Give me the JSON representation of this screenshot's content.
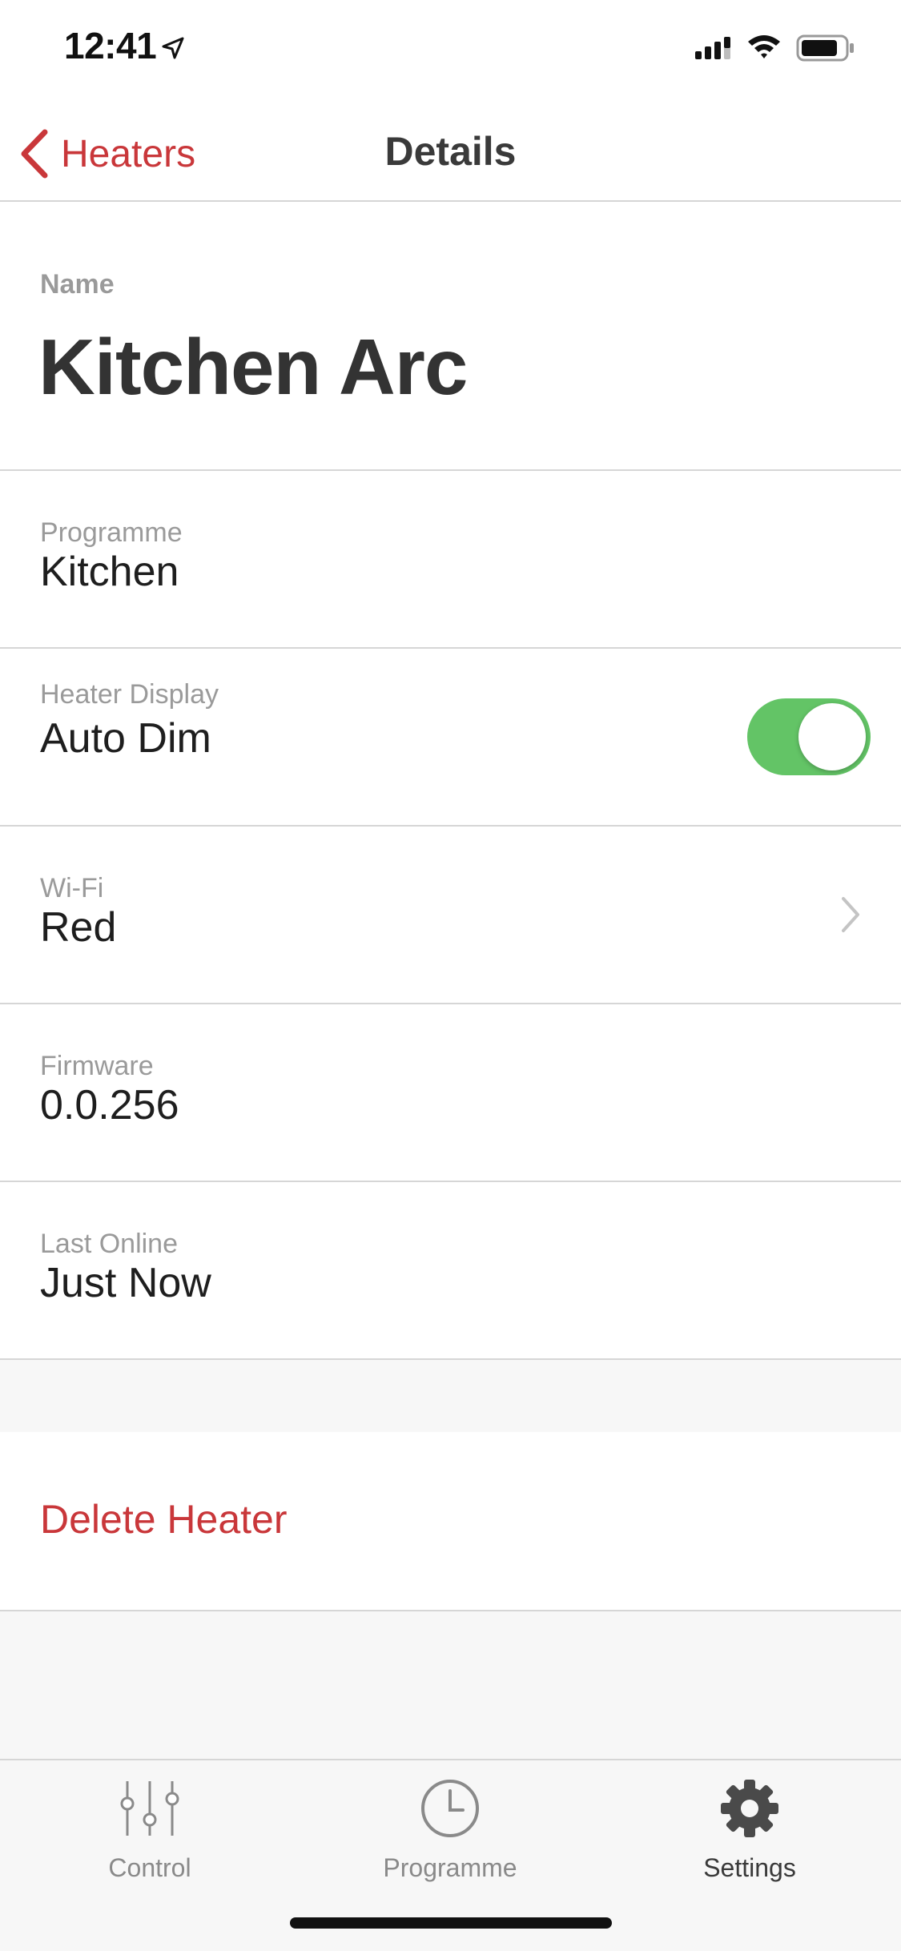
{
  "status_bar": {
    "time": "12:41",
    "icons": [
      "location-arrow-icon",
      "cellular-signal-icon",
      "wifi-icon",
      "battery-icon"
    ]
  },
  "nav": {
    "back_label": "Heaters",
    "title": "Details"
  },
  "details": {
    "name_label": "Name",
    "name_value": "Kitchen Arc",
    "programme_label": "Programme",
    "programme_value": "Kitchen",
    "display_label": "Heater Display",
    "display_value": "Auto Dim",
    "display_toggle_on": true,
    "wifi_label": "Wi-Fi",
    "wifi_value": "Red",
    "firmware_label": "Firmware",
    "firmware_value": "0.0.256",
    "last_online_label": "Last Online",
    "last_online_value": "Just Now"
  },
  "actions": {
    "delete_label": "Delete Heater"
  },
  "tabs": [
    {
      "label": "Control",
      "icon": "sliders-icon",
      "active": false
    },
    {
      "label": "Programme",
      "icon": "clock-icon",
      "active": false
    },
    {
      "label": "Settings",
      "icon": "gear-icon",
      "active": true
    }
  ],
  "colors": {
    "accent_red": "#c9373a",
    "toggle_green": "#63c466",
    "label_gray": "#9a9a9a",
    "divider": "#d6d6d6",
    "background": "#f7f7f7"
  }
}
